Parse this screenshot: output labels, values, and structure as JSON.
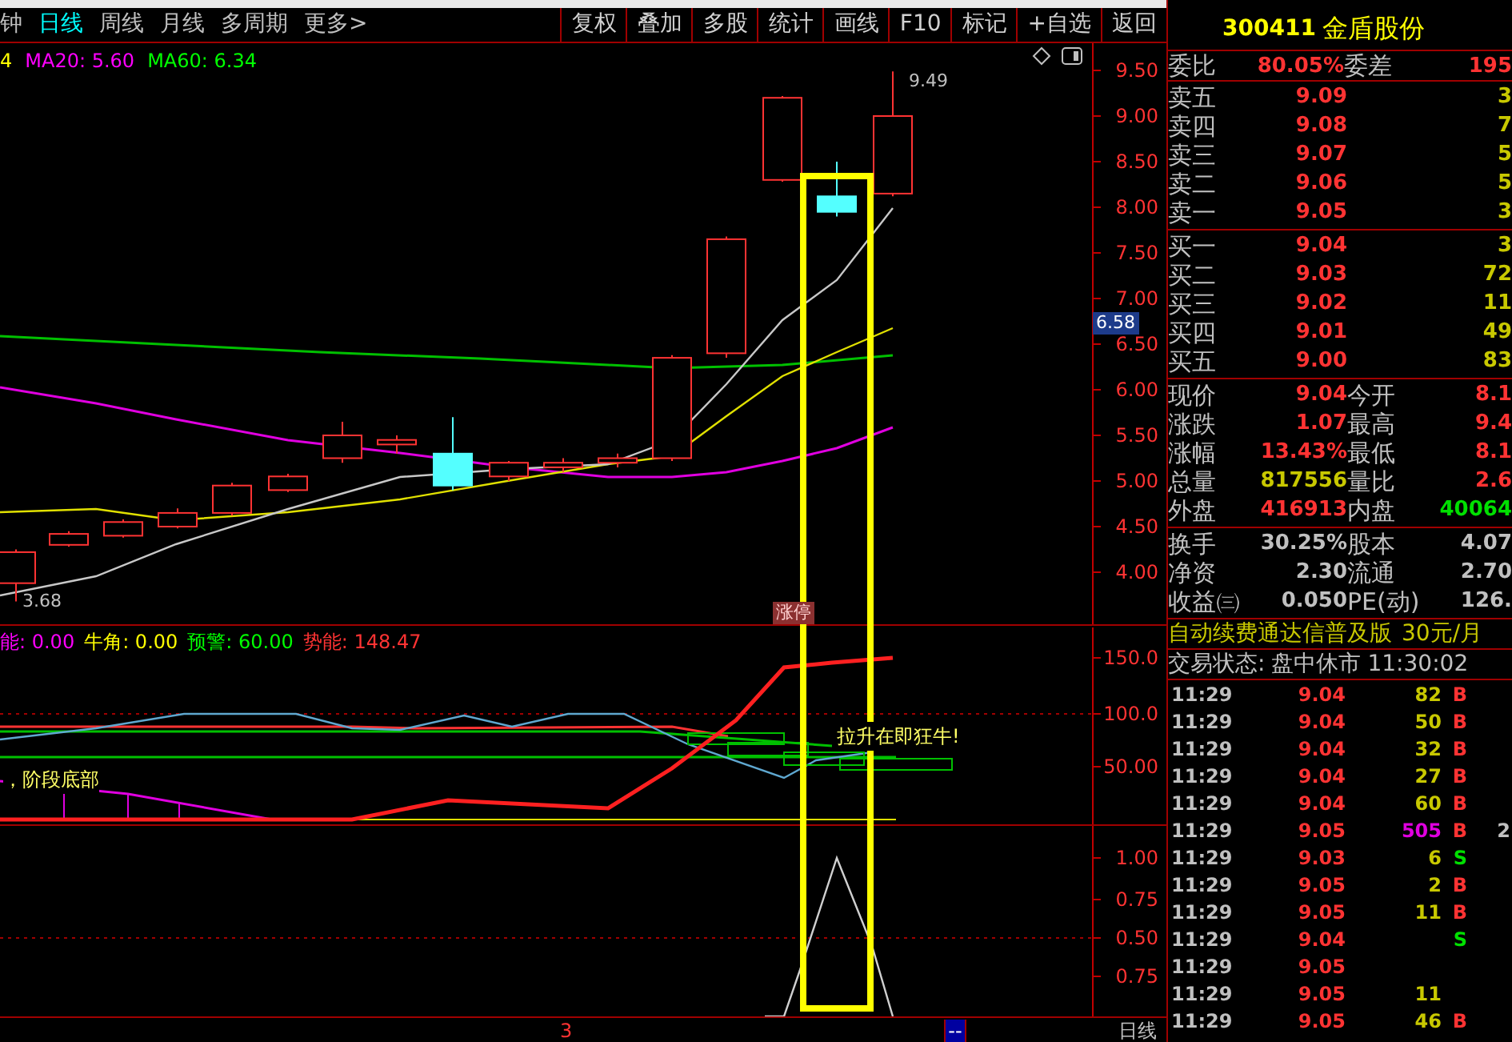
{
  "period_tabs": [
    {
      "label": "钟",
      "selected": false
    },
    {
      "label": "日线",
      "selected": true
    },
    {
      "label": "周线",
      "selected": false
    },
    {
      "label": "月线",
      "selected": false
    },
    {
      "label": "多周期",
      "selected": false
    },
    {
      "label": "更多>",
      "selected": false
    }
  ],
  "toolbar_buttons": [
    "复权",
    "叠加",
    "多股",
    "统计",
    "画线",
    "F10",
    "标记",
    "+自选",
    "返回"
  ],
  "price_chart": {
    "legend": [
      {
        "text": "4",
        "color": "#ffff00"
      },
      {
        "text": "MA20: 5.60",
        "color": "#ff00ff"
      },
      {
        "text": "MA60: 6.34",
        "color": "#00ff00"
      }
    ],
    "axis_labels": [
      "9.50",
      "9.00",
      "8.50",
      "8.00",
      "7.50",
      "7.00",
      "6.50",
      "6.00",
      "5.50",
      "5.00",
      "4.50",
      "4.00"
    ],
    "high_label": "9.49",
    "low_label": "3.68",
    "current_price_tag": "6.58",
    "limit_up_tag": "涨停"
  },
  "indicator_pane": {
    "legend": [
      {
        "text": "能: 0.00",
        "color": "#ff00ff"
      },
      {
        "text": "牛角: 0.00",
        "color": "#ffff00"
      },
      {
        "text": "预警: 60.00",
        "color": "#00ff00"
      },
      {
        "text": "势能: 148.47",
        "color": "#ff3333"
      }
    ],
    "axis_labels": [
      "150.0",
      "100.0",
      "50.00"
    ],
    "signal_left": "，阶段底部",
    "signal_right": "拉升在即狂牛!"
  },
  "lower_pane": {
    "axis_labels": [
      "1.00",
      "0.75",
      "0.50",
      "0.75"
    ]
  },
  "bottom_bar": {
    "marker": "3",
    "box_label": "--",
    "period": "日线"
  },
  "quote": {
    "code": "300411",
    "name": "金盾股份",
    "ratio_label": "委比",
    "ratio": "80.05%",
    "diff_label": "委差",
    "diff": "195",
    "asks": [
      {
        "label": "卖五",
        "price": "9.09",
        "volume": "3"
      },
      {
        "label": "卖四",
        "price": "9.08",
        "volume": "7"
      },
      {
        "label": "卖三",
        "price": "9.07",
        "volume": "5"
      },
      {
        "label": "卖二",
        "price": "9.06",
        "volume": "5"
      },
      {
        "label": "卖一",
        "price": "9.05",
        "volume": "3"
      }
    ],
    "bids": [
      {
        "label": "买一",
        "price": "9.04",
        "volume": "3"
      },
      {
        "label": "买二",
        "price": "9.03",
        "volume": "72"
      },
      {
        "label": "买三",
        "price": "9.02",
        "volume": "11"
      },
      {
        "label": "买四",
        "price": "9.01",
        "volume": "49"
      },
      {
        "label": "买五",
        "price": "9.00",
        "volume": "83"
      }
    ],
    "stats": [
      {
        "label": "现价",
        "value": "9.04",
        "color": "#ff3333"
      },
      {
        "label": "今开",
        "value": "8.1",
        "color": "#ff3333"
      },
      {
        "label": "涨跌",
        "value": "1.07",
        "color": "#ff3333"
      },
      {
        "label": "最高",
        "value": "9.4",
        "color": "#ff3333"
      },
      {
        "label": "涨幅",
        "value": "13.43%",
        "color": "#ff3333"
      },
      {
        "label": "最低",
        "value": "8.1",
        "color": "#ff3333"
      },
      {
        "label": "总量",
        "value": "817556",
        "color": "#c8c800"
      },
      {
        "label": "量比",
        "value": "2.6",
        "color": "#ff3333"
      },
      {
        "label": "外盘",
        "value": "416913",
        "color": "#ff3333"
      },
      {
        "label": "内盘",
        "value": "40064",
        "color": "#00e000"
      }
    ],
    "fundamentals": [
      {
        "label": "换手",
        "value": "30.25%"
      },
      {
        "label": "股本",
        "value": "4.07"
      },
      {
        "label": "净资",
        "value": "2.30"
      },
      {
        "label": "流通",
        "value": "2.70"
      },
      {
        "label": "收益㈢",
        "value": "0.050"
      },
      {
        "label": "PE(动)",
        "value": "126."
      }
    ],
    "banner": "自动续费通达信普及版",
    "banner_price": "30元/月",
    "status_label": "交易状态:",
    "status": "盘中休市",
    "status_time": "11:30:02",
    "trades": [
      {
        "time": "11:29",
        "price": "9.04",
        "volume": "82",
        "side": "B",
        "kind": "buy",
        "large": false
      },
      {
        "time": "11:29",
        "price": "9.04",
        "volume": "50",
        "side": "B",
        "kind": "buy",
        "large": false
      },
      {
        "time": "11:29",
        "price": "9.04",
        "volume": "32",
        "side": "B",
        "kind": "buy",
        "large": false
      },
      {
        "time": "11:29",
        "price": "9.04",
        "volume": "27",
        "side": "B",
        "kind": "buy",
        "large": false
      },
      {
        "time": "11:29",
        "price": "9.04",
        "volume": "60",
        "side": "B",
        "kind": "buy",
        "large": false
      },
      {
        "time": "11:29",
        "price": "9.05",
        "volume": "505",
        "side": "B",
        "kind": "buy",
        "large": true,
        "extra": "2"
      },
      {
        "time": "11:29",
        "price": "9.03",
        "volume": "6",
        "side": "S",
        "kind": "sell",
        "large": false
      },
      {
        "time": "11:29",
        "price": "9.05",
        "volume": "2",
        "side": "B",
        "kind": "buy",
        "large": false
      },
      {
        "time": "11:29",
        "price": "9.05",
        "volume": "11",
        "side": "B",
        "kind": "buy",
        "large": false
      },
      {
        "time": "11:29",
        "price": "9.04",
        "side": "S",
        "kind": "sell"
      },
      {
        "time": "11:29",
        "price": "9.05"
      },
      {
        "time": "11:29",
        "price": "9.05",
        "volume": "11",
        "large": false
      },
      {
        "time": "11:29",
        "price": "9.05",
        "volume": "46",
        "side": "B",
        "kind": "buy",
        "large": false
      }
    ]
  }
}
